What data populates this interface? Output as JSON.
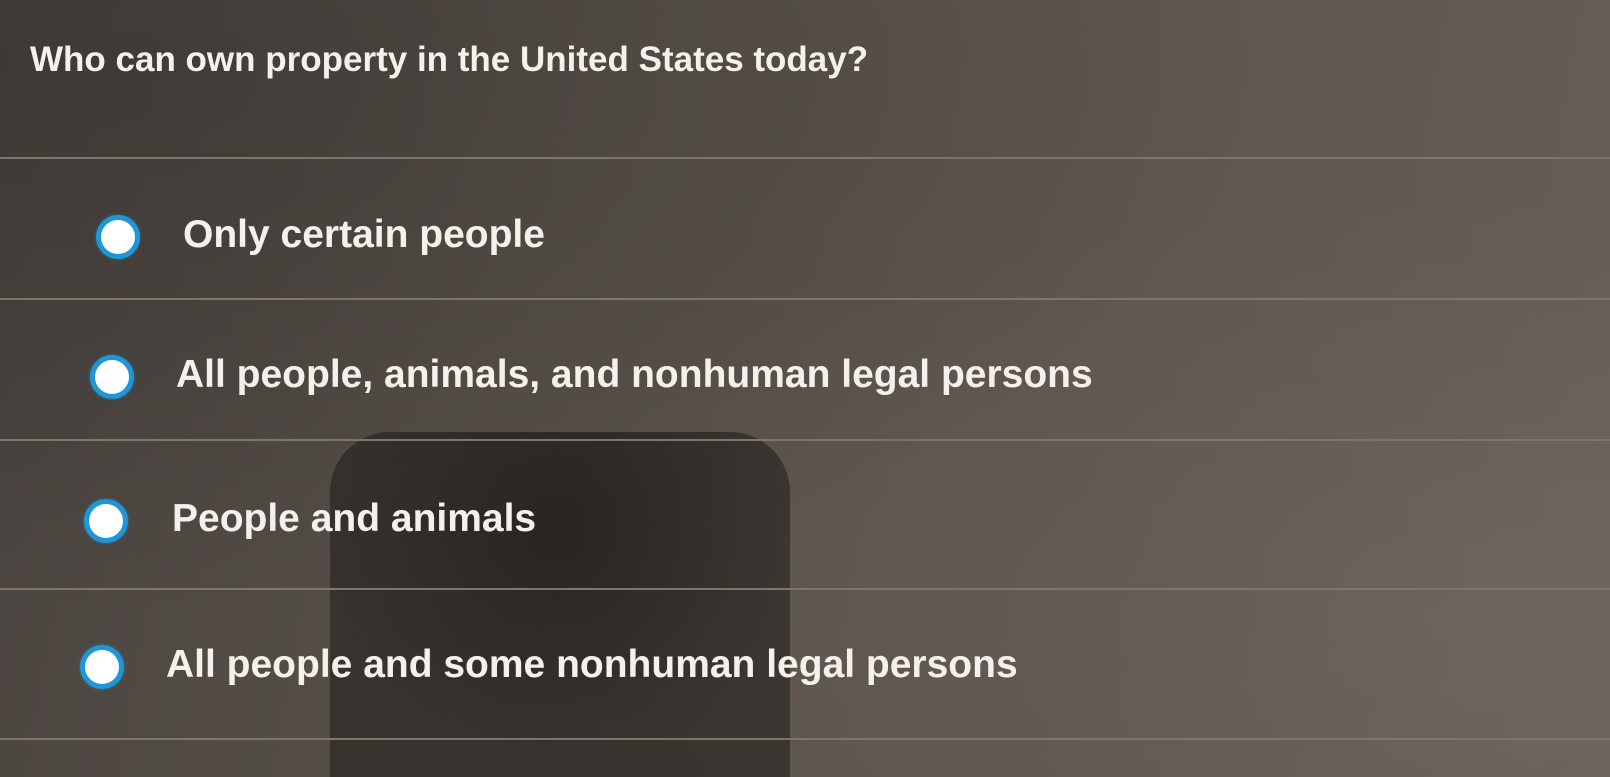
{
  "question": {
    "text": "Who can own property in the United States today?"
  },
  "options": [
    {
      "label": "Only certain people",
      "selected": false
    },
    {
      "label": "All people, animals, and nonhuman legal persons",
      "selected": false
    },
    {
      "label": "People and animals",
      "selected": false
    },
    {
      "label": "All people and some nonhuman legal persons",
      "selected": false
    }
  ],
  "colors": {
    "radio_border": "#1f97d6",
    "text": "#f4f1ec",
    "divider": "#7e766c"
  }
}
